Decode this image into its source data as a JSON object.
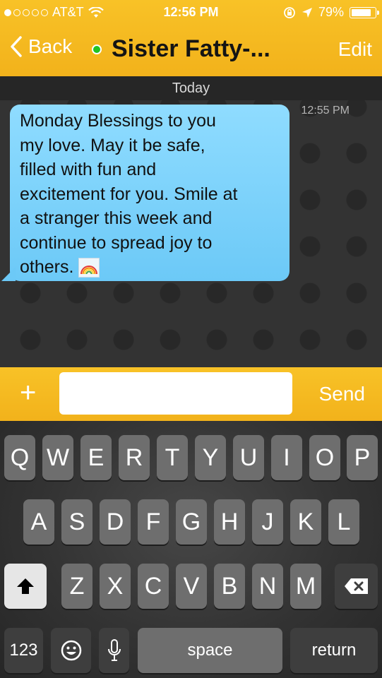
{
  "status_bar": {
    "carrier": "AT&T",
    "time": "12:56 PM",
    "battery": "79%",
    "battery_level": 0.79,
    "signal_bars_filled": 1,
    "signal_bars_total": 5
  },
  "nav": {
    "back_label": "Back",
    "title": "Sister Fatty-...",
    "edit_label": "Edit",
    "online_color": "#22c322"
  },
  "chat": {
    "date_separator": "Today",
    "messages": [
      {
        "time": "12:55 PM",
        "lines": [
          "Monday Blessings to you",
          "my love. May it be safe,",
          "filled with fun and",
          "excitement for you. Smile at",
          "a stranger this week and",
          "continue to spread joy to",
          "others."
        ],
        "emoji": "rainbow"
      }
    ]
  },
  "compose": {
    "input_value": "",
    "send_label": "Send",
    "add_label": "+"
  },
  "keyboard": {
    "row1": [
      "Q",
      "W",
      "E",
      "R",
      "T",
      "Y",
      "U",
      "I",
      "O",
      "P"
    ],
    "row2": [
      "A",
      "S",
      "D",
      "F",
      "G",
      "H",
      "J",
      "K",
      "L"
    ],
    "row3": [
      "Z",
      "X",
      "C",
      "V",
      "B",
      "N",
      "M"
    ],
    "numbers_label": "123",
    "space_label": "space",
    "return_label": "return"
  },
  "colors": {
    "accent_yellow": "#f5b91f",
    "bubble_blue": "#7dd2fb",
    "chat_bg": "#333333"
  }
}
